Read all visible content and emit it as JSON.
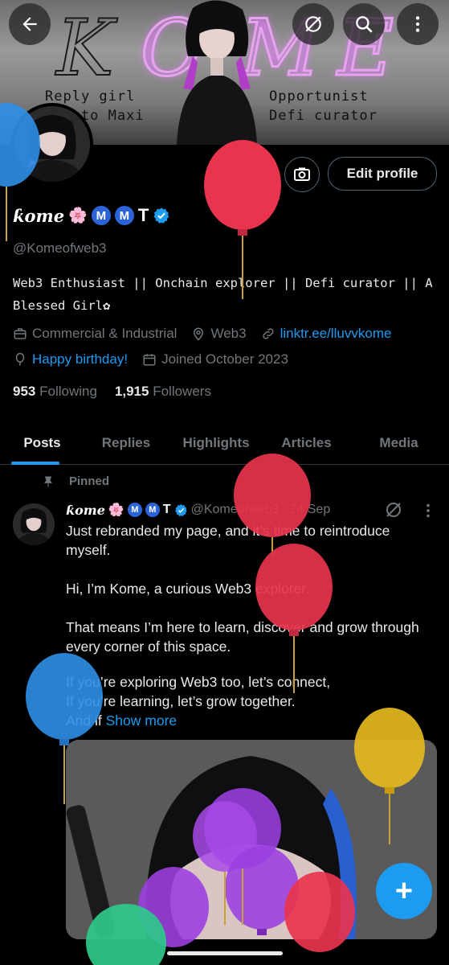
{
  "banner": {
    "letters": [
      "K",
      "O",
      "M",
      "E"
    ],
    "left_text": [
      "Reply girl",
      "Ontoto Maxi"
    ],
    "right_text": [
      "Opportunist",
      "Defi curator"
    ]
  },
  "top_buttons": {
    "back": "back-arrow-icon",
    "noise": "no-entry-icon",
    "search": "search-icon",
    "more": "more-vertical-icon"
  },
  "profile": {
    "edit_label": "Edit profile",
    "display_name": "ƙome",
    "name_emoji": "🌸",
    "name_badges": [
      "M",
      "M"
    ],
    "name_letter": "T",
    "handle": "@Komeofweb3",
    "bio": "Web3 Enthusiast || Onchain explorer || Defi curator || A Blessed Girl✿",
    "category": "Commercial & Industrial",
    "location": "Web3",
    "link": "linktr.ee/lluvvkome",
    "birthday": "Happy birthday!",
    "joined": "Joined October 2023",
    "following_count": "953",
    "following_label": "Following",
    "followers_count": "1,915",
    "followers_label": "Followers"
  },
  "tabs": [
    "Posts",
    "Replies",
    "Highlights",
    "Articles",
    "Media"
  ],
  "post": {
    "pinned_label": "Pinned",
    "author_name": "ƙome",
    "author_emoji": "🌸",
    "author_badges": [
      "M",
      "M"
    ],
    "author_letter": "T",
    "author_handle": "@Komeofweb3",
    "separator": "·",
    "date": "24 Sep",
    "paragraphs": [
      "Just rebranded my page, and it’s time to reintroduce myself.",
      "Hi, I’m Kome, a curious Web3 explorer.",
      "That means I’m here to learn, discover and grow through every corner of this space."
    ],
    "line_a": "If you’re exploring Web3 too, let’s connect,",
    "line_b": "If you’re learning, let’s grow together.",
    "line_c": "And if",
    "show_more": "Show more"
  },
  "fab_label": "+",
  "colors": {
    "accent": "#1d9bf0",
    "background": "#000000",
    "muted": "#71767b",
    "badge_blue": "#2b63d9",
    "balloon_red": "#e8344e",
    "balloon_purple": "#9b3fe0",
    "balloon_blue": "#2f8fe6",
    "balloon_yellow": "#e6b820",
    "balloon_green": "#2ec98a"
  }
}
